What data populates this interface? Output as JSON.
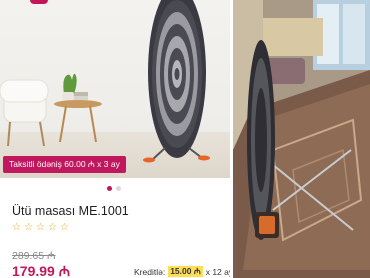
{
  "product": {
    "title": "Ütü masası ME.1001",
    "rating_stars": 5,
    "old_price": "289.65 ₼",
    "new_price": "179.99 ₼"
  },
  "banner": {
    "installment_text": "Taksitli ödəniş 60.00 ₼ x 3 ay"
  },
  "carousel": {
    "total": 2,
    "active": 1
  },
  "credit": {
    "label": "Kreditlə:",
    "amount": "15.00 ₼",
    "term": "x 12 ay"
  },
  "icons": {
    "star": "star-icon"
  },
  "colors": {
    "accent": "#c2185b",
    "star": "#f0a828",
    "credit_highlight": "#ffde57"
  }
}
